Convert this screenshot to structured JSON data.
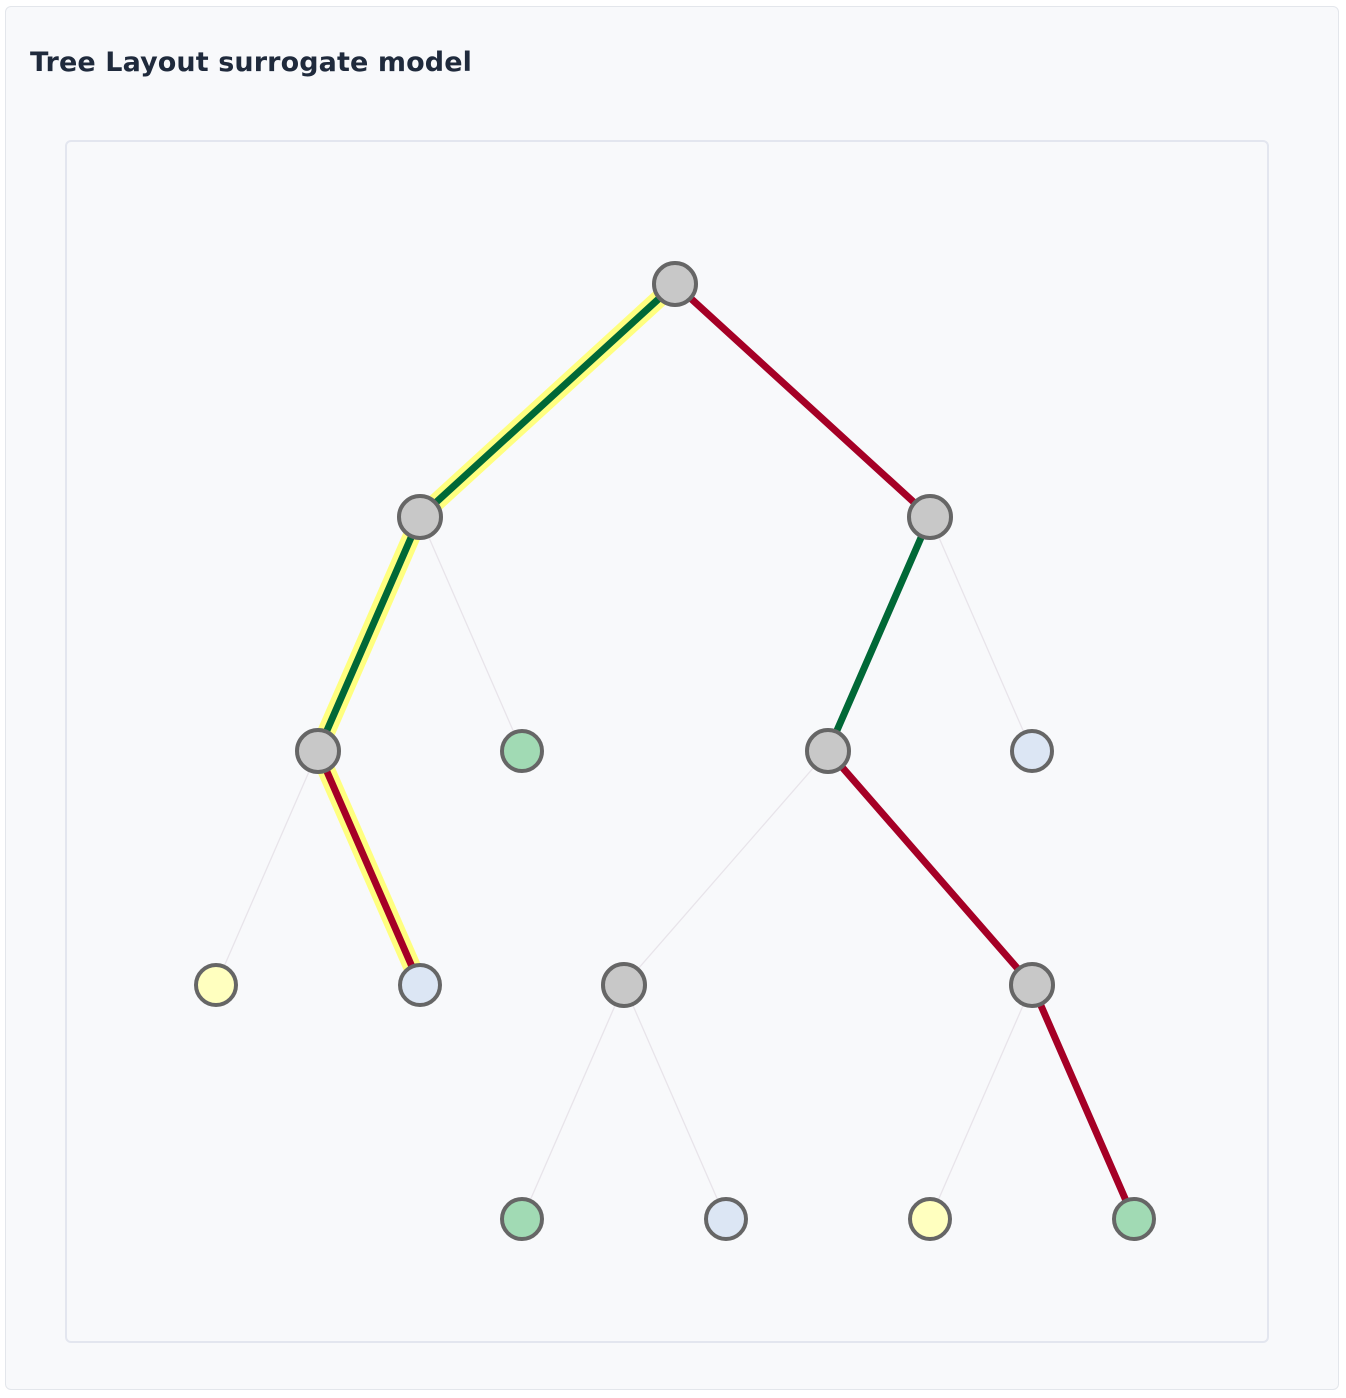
{
  "title": "Tree Layout surrogate model",
  "colors": {
    "highlight": "#ffff80",
    "positive_edge": "#006837",
    "negative_edge": "#a50026",
    "faint_edge": "#e8e4ea",
    "node_stroke": "#666666",
    "internal_fill": "#c8c8c8",
    "class_green": "#a1dab4",
    "class_blue": "#dce6f4",
    "class_yellow": "#ffffbf"
  },
  "tree": {
    "nodes": [
      {
        "id": "n0",
        "kind": "internal",
        "fill": "internal_fill"
      },
      {
        "id": "n1",
        "kind": "internal",
        "fill": "internal_fill"
      },
      {
        "id": "n2",
        "kind": "internal",
        "fill": "internal_fill"
      },
      {
        "id": "n3",
        "kind": "internal",
        "fill": "internal_fill"
      },
      {
        "id": "n4",
        "kind": "leaf",
        "fill": "class_green"
      },
      {
        "id": "n5",
        "kind": "internal",
        "fill": "internal_fill"
      },
      {
        "id": "n6",
        "kind": "leaf",
        "fill": "class_blue"
      },
      {
        "id": "n7",
        "kind": "leaf",
        "fill": "class_yellow"
      },
      {
        "id": "n8",
        "kind": "leaf",
        "fill": "class_blue"
      },
      {
        "id": "n9",
        "kind": "internal",
        "fill": "internal_fill"
      },
      {
        "id": "n10",
        "kind": "internal",
        "fill": "internal_fill"
      },
      {
        "id": "n11",
        "kind": "leaf",
        "fill": "class_green"
      },
      {
        "id": "n12",
        "kind": "leaf",
        "fill": "class_blue"
      },
      {
        "id": "n13",
        "kind": "leaf",
        "fill": "class_yellow"
      },
      {
        "id": "n14",
        "kind": "leaf",
        "fill": "class_green"
      }
    ],
    "edges": [
      {
        "from": "n0",
        "to": "n1",
        "style": "positive",
        "highlight": true
      },
      {
        "from": "n0",
        "to": "n2",
        "style": "negative",
        "highlight": false
      },
      {
        "from": "n1",
        "to": "n3",
        "style": "positive",
        "highlight": true
      },
      {
        "from": "n1",
        "to": "n4",
        "style": "faint",
        "highlight": false
      },
      {
        "from": "n2",
        "to": "n5",
        "style": "positive",
        "highlight": false
      },
      {
        "from": "n2",
        "to": "n6",
        "style": "faint",
        "highlight": false
      },
      {
        "from": "n3",
        "to": "n7",
        "style": "faint",
        "highlight": false
      },
      {
        "from": "n3",
        "to": "n8",
        "style": "negative",
        "highlight": true
      },
      {
        "from": "n5",
        "to": "n9",
        "style": "faint",
        "highlight": false
      },
      {
        "from": "n5",
        "to": "n10",
        "style": "negative",
        "highlight": false
      },
      {
        "from": "n9",
        "to": "n11",
        "style": "faint",
        "highlight": false
      },
      {
        "from": "n9",
        "to": "n12",
        "style": "faint",
        "highlight": false
      },
      {
        "from": "n10",
        "to": "n13",
        "style": "faint",
        "highlight": false
      },
      {
        "from": "n10",
        "to": "n14",
        "style": "negative",
        "highlight": false
      }
    ]
  }
}
